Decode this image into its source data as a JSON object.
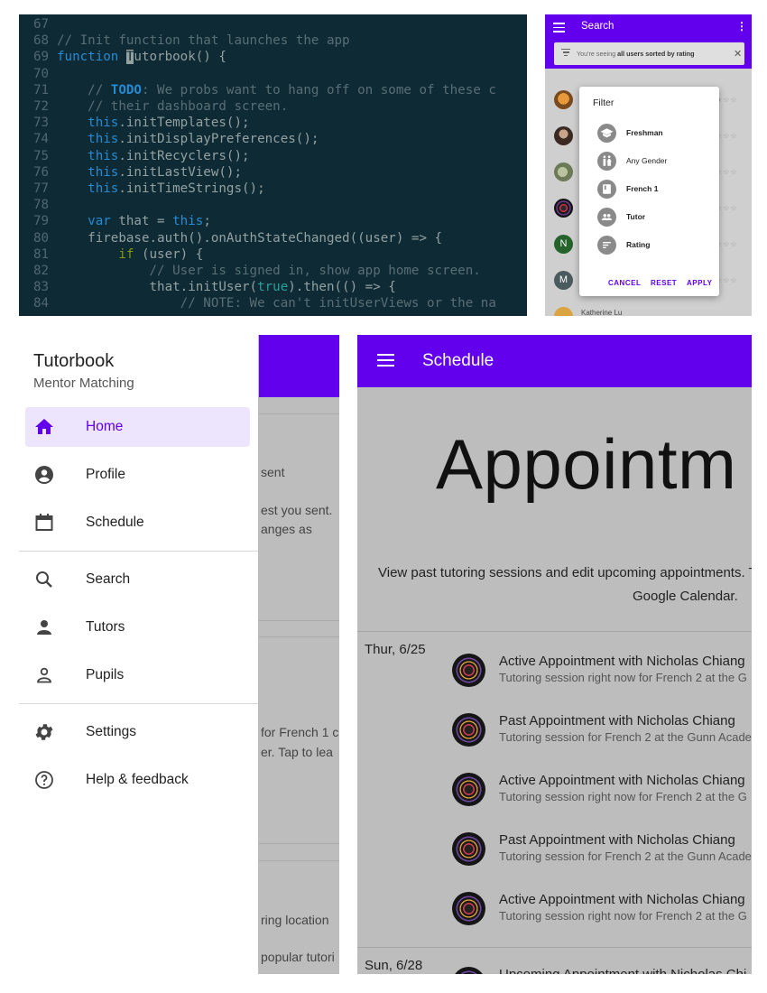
{
  "code_editor": {
    "lines": [
      {
        "n": "67",
        "segs": [
          {
            "t": "",
            "c": "code-text"
          }
        ]
      },
      {
        "n": "68",
        "segs": [
          {
            "t": "// Init function that launches the app",
            "c": "c-com"
          }
        ]
      },
      {
        "n": "69",
        "segs": [
          {
            "t": "function ",
            "c": "c-fn"
          },
          {
            "t": "T",
            "c": "c-cur"
          },
          {
            "t": "utorbook() {",
            "c": "code-text"
          }
        ]
      },
      {
        "n": "70",
        "segs": [
          {
            "t": "",
            "c": "code-text"
          }
        ]
      },
      {
        "n": "71",
        "segs": [
          {
            "t": "    // ",
            "c": "c-com"
          },
          {
            "t": "TODO",
            "c": "c-todo"
          },
          {
            "t": ": We probs want to hang off on some of these c",
            "c": "c-com"
          }
        ]
      },
      {
        "n": "72",
        "segs": [
          {
            "t": "    // their dashboard screen.",
            "c": "c-com"
          }
        ]
      },
      {
        "n": "73",
        "segs": [
          {
            "t": "    ",
            "c": "code-text"
          },
          {
            "t": "this",
            "c": "c-fn"
          },
          {
            "t": ".initTemplates();",
            "c": "code-text"
          }
        ]
      },
      {
        "n": "74",
        "segs": [
          {
            "t": "    ",
            "c": "code-text"
          },
          {
            "t": "this",
            "c": "c-fn"
          },
          {
            "t": ".initDisplayPreferences();",
            "c": "code-text"
          }
        ]
      },
      {
        "n": "75",
        "segs": [
          {
            "t": "    ",
            "c": "code-text"
          },
          {
            "t": "this",
            "c": "c-fn"
          },
          {
            "t": ".initRecyclers();",
            "c": "code-text"
          }
        ]
      },
      {
        "n": "76",
        "segs": [
          {
            "t": "    ",
            "c": "code-text"
          },
          {
            "t": "this",
            "c": "c-fn"
          },
          {
            "t": ".initLastView();",
            "c": "code-text"
          }
        ]
      },
      {
        "n": "77",
        "segs": [
          {
            "t": "    ",
            "c": "code-text"
          },
          {
            "t": "this",
            "c": "c-fn"
          },
          {
            "t": ".initTimeStrings();",
            "c": "code-text"
          }
        ]
      },
      {
        "n": "78",
        "segs": [
          {
            "t": "",
            "c": "code-text"
          }
        ]
      },
      {
        "n": "79",
        "segs": [
          {
            "t": "    ",
            "c": "code-text"
          },
          {
            "t": "var",
            "c": "c-fn"
          },
          {
            "t": " that = ",
            "c": "code-text"
          },
          {
            "t": "this",
            "c": "c-fn"
          },
          {
            "t": ";",
            "c": "code-text"
          }
        ]
      },
      {
        "n": "80",
        "segs": [
          {
            "t": "    firebase.auth().onAuthStateChanged((user) => {",
            "c": "code-text"
          }
        ]
      },
      {
        "n": "81",
        "segs": [
          {
            "t": "        ",
            "c": "code-text"
          },
          {
            "t": "if",
            "c": "c-kw"
          },
          {
            "t": " (user) {",
            "c": "code-text"
          }
        ]
      },
      {
        "n": "82",
        "segs": [
          {
            "t": "            // User is signed in, show app home screen.",
            "c": "c-com"
          }
        ]
      },
      {
        "n": "83",
        "segs": [
          {
            "t": "            that.initUser(",
            "c": "code-text"
          },
          {
            "t": "true",
            "c": "c-bool"
          },
          {
            "t": ").then(() => {",
            "c": "code-text"
          }
        ]
      },
      {
        "n": "84",
        "segs": [
          {
            "t": "                // NOTE: We can't initUserViews or the na",
            "c": "c-com"
          }
        ]
      }
    ]
  },
  "search_screen": {
    "title": "Search",
    "more": "⋮",
    "notice_prefix": "You're seeing ",
    "notice_bold": "all users sorted by rating",
    "notice_close": "✕",
    "stars": "★☆☆",
    "star_rows": [
      "★☆☆",
      "☆☆☆",
      "☆☆☆",
      "☆☆☆",
      "☆☆☆",
      "☆☆☆"
    ],
    "avatar_n": "N",
    "avatar_m": "M",
    "last_name": "Katherine Lu",
    "filter_dialog": {
      "title": "Filter",
      "options": [
        {
          "label": "Freshman",
          "icon": "school-icon",
          "bold": true
        },
        {
          "label": "Any Gender",
          "icon": "wc-icon",
          "bold": false
        },
        {
          "label": "French 1",
          "icon": "book-icon",
          "bold": true
        },
        {
          "label": "Tutor",
          "icon": "people-icon",
          "bold": true
        },
        {
          "label": "Rating",
          "icon": "sort-icon",
          "bold": true
        }
      ],
      "cancel": "CANCEL",
      "reset": "RESET",
      "apply": "APPLY"
    }
  },
  "drawer": {
    "title": "Tutorbook",
    "subtitle": "Mentor Matching",
    "items": [
      {
        "label": "Home",
        "icon": "home-icon",
        "active": true
      },
      {
        "label": "Profile",
        "icon": "account-circle-icon",
        "active": false
      },
      {
        "label": "Schedule",
        "icon": "calendar-icon",
        "active": false
      },
      {
        "label": "Search",
        "icon": "search-icon",
        "active": false
      },
      {
        "label": "Tutors",
        "icon": "person-icon",
        "active": false
      },
      {
        "label": "Pupils",
        "icon": "person-outline-icon",
        "active": false
      },
      {
        "label": "Settings",
        "icon": "gear-icon",
        "active": false
      },
      {
        "label": "Help & feedback",
        "icon": "help-icon",
        "active": false
      }
    ],
    "background_fragments": [
      "sent",
      "est you sent.",
      "anges as",
      "for French 1 c",
      "er. Tap to lea",
      "ring location",
      "popular tutori"
    ]
  },
  "schedule_screen": {
    "title": "Schedule",
    "heading": "Appointm",
    "description_line1": "View past tutoring sessions and edit upcoming appointments. T",
    "description_line2": "Google Calendar.",
    "groups": [
      {
        "date": "Thur, 6/25",
        "rows": [
          {
            "title": "Active Appointment with Nicholas Chiang",
            "subtitle": "Tutoring session right now for French 2 at the G"
          },
          {
            "title": "Past Appointment with Nicholas Chiang",
            "subtitle": "Tutoring session for French 2 at the Gunn Acade"
          },
          {
            "title": "Active Appointment with Nicholas Chiang",
            "subtitle": "Tutoring session right now for French 2 at the G"
          },
          {
            "title": "Past Appointment with Nicholas Chiang",
            "subtitle": "Tutoring session for French 2 at the Gunn Acade"
          },
          {
            "title": "Active Appointment with Nicholas Chiang",
            "subtitle": "Tutoring session right now for French 2 at the G"
          }
        ]
      },
      {
        "date": "Sun, 6/28",
        "rows": [
          {
            "title": "Upcoming Appointment with Nicholas Chi",
            "subtitle": ""
          }
        ]
      }
    ]
  },
  "colors": {
    "primary": "#6200ee",
    "code_bg": "#0e2a35",
    "drawer_active_bg": "#ede4fd",
    "scrim": "#bdbdbd"
  }
}
